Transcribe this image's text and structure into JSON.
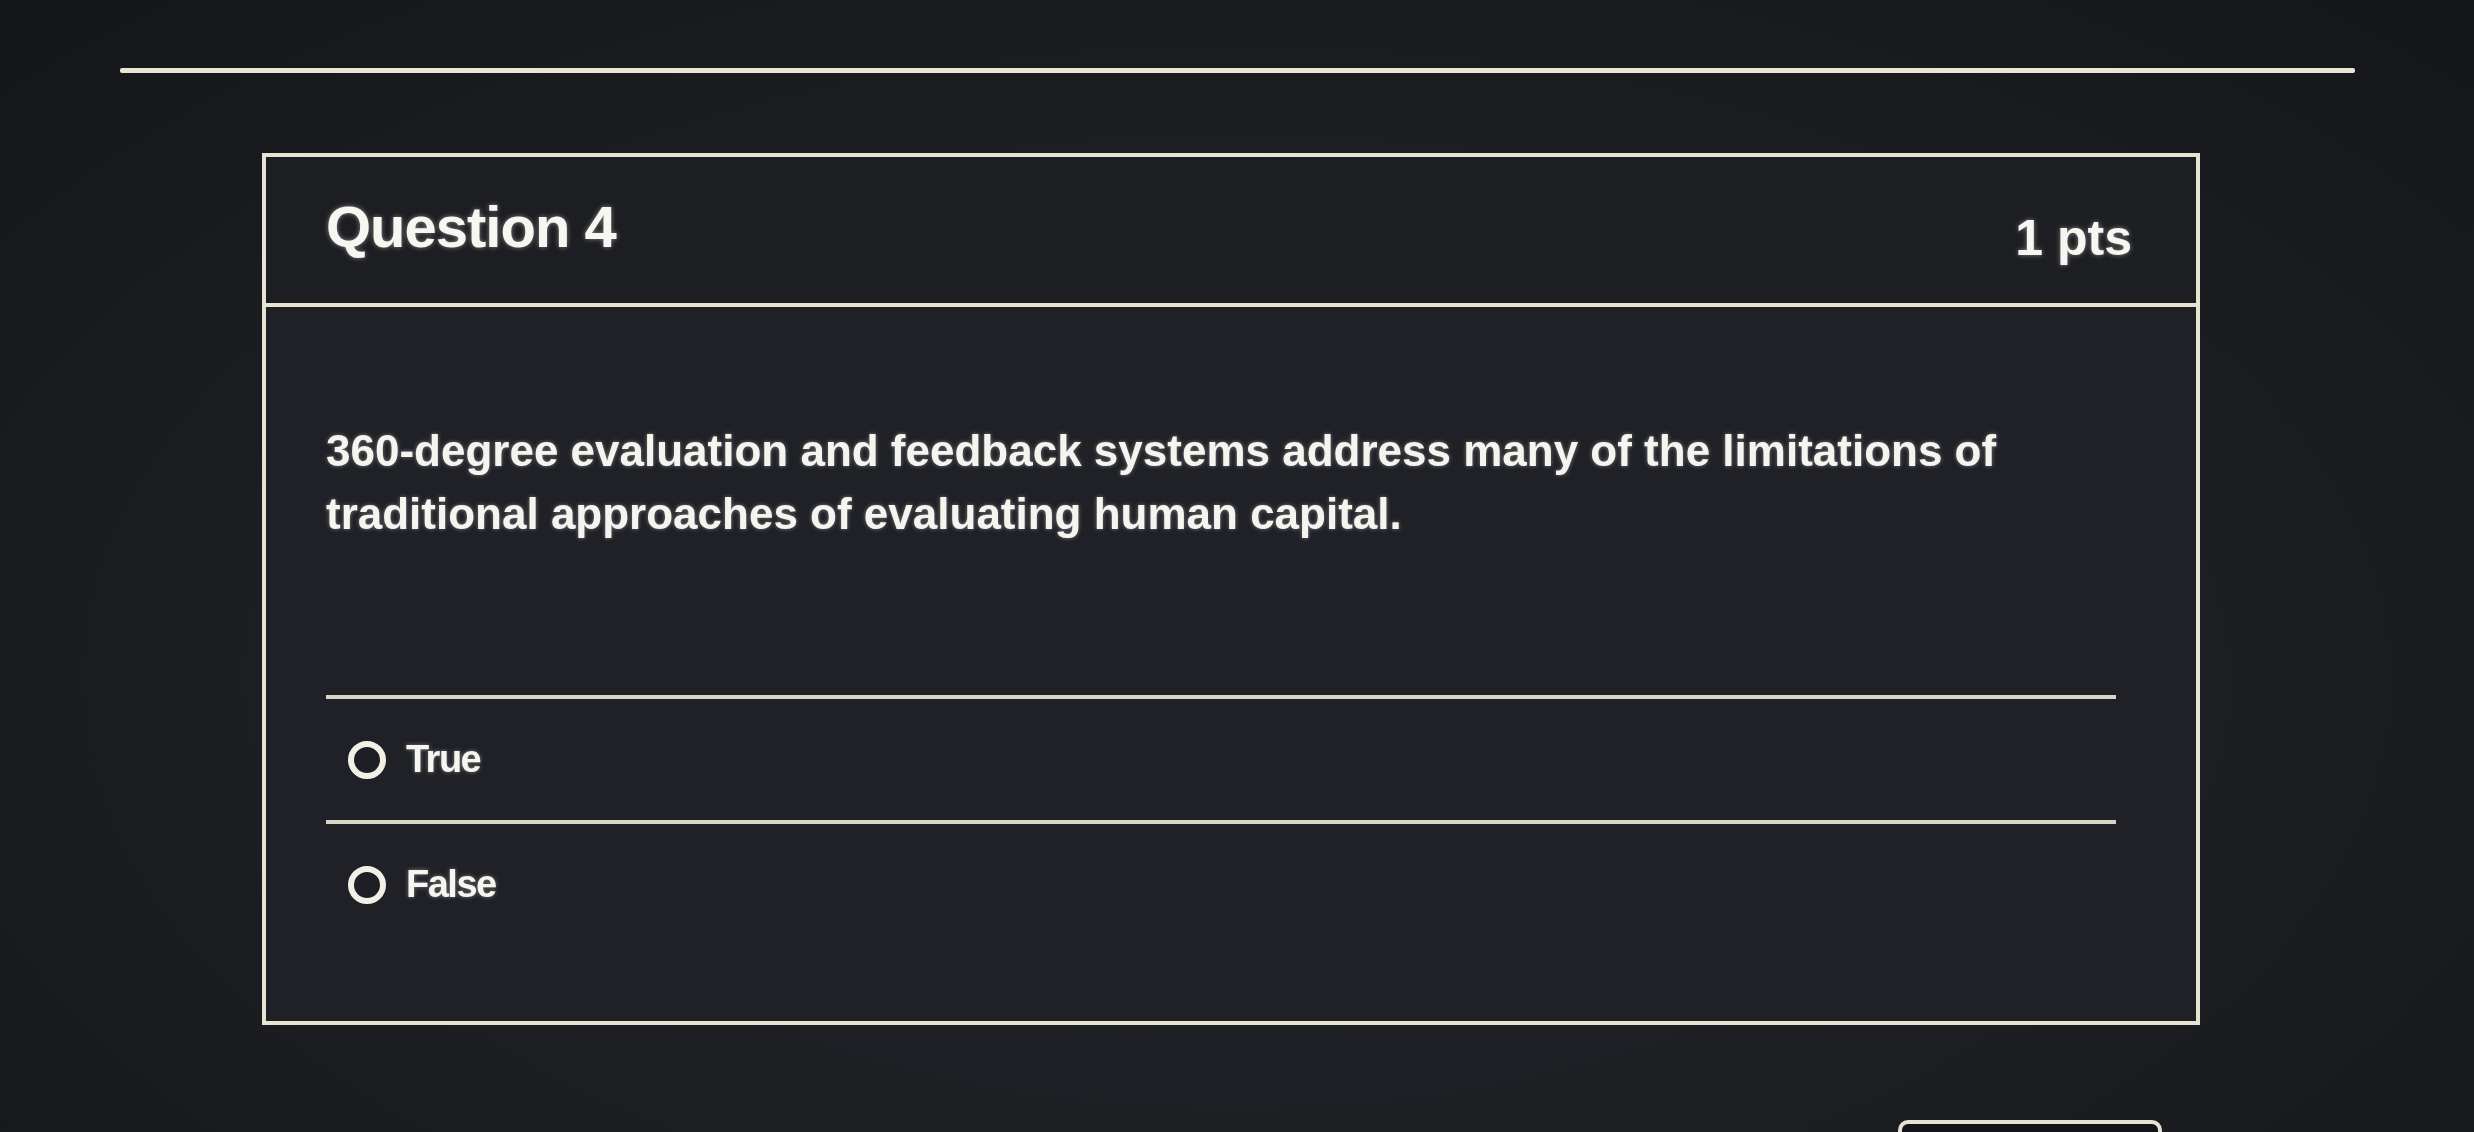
{
  "question": {
    "title": "Question 4",
    "points": "1 pts",
    "text": "360-degree evaluation and feedback systems address many of the limitations of traditional approaches of evaluating human capital.",
    "answers": [
      {
        "label": "True",
        "selected": false
      },
      {
        "label": "False",
        "selected": false
      }
    ]
  }
}
